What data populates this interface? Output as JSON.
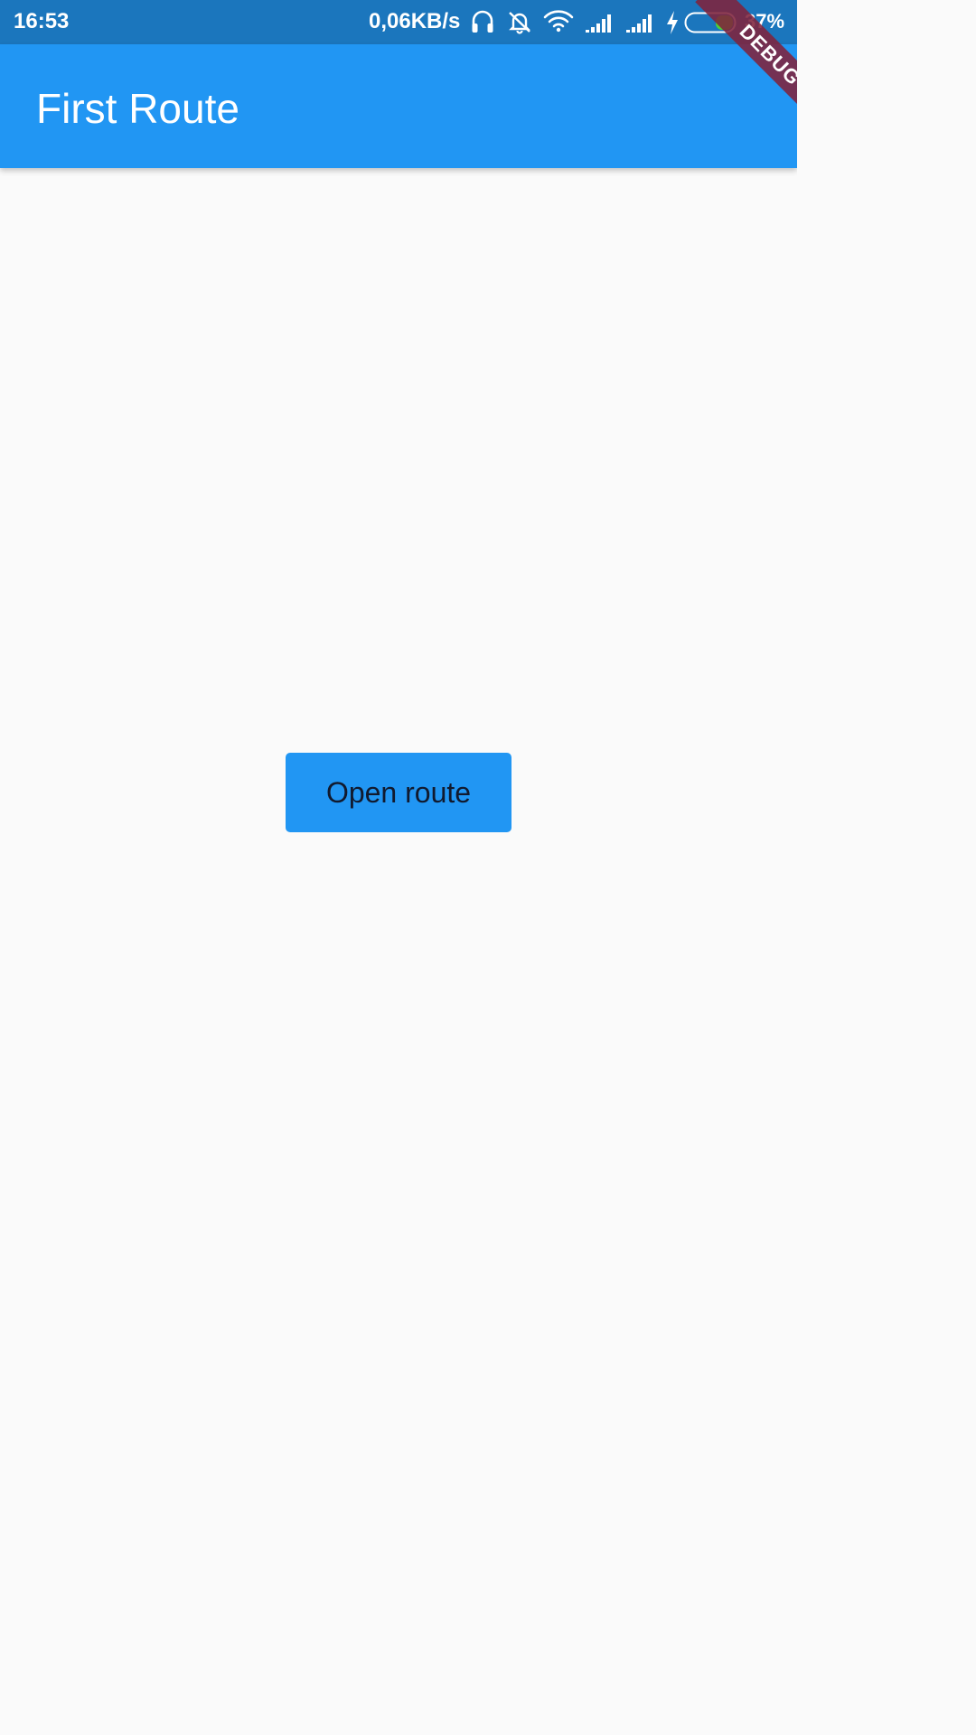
{
  "status_bar": {
    "time": "16:53",
    "network_speed": "0,06KB/s",
    "battery_percent": "37%",
    "icons": [
      "headphones-icon",
      "bell-off-icon",
      "wifi-icon",
      "signal-icon",
      "signal-icon",
      "charging-bolt-icon",
      "battery-icon"
    ],
    "battery_level": 0.37,
    "battery_color": "#4cd137"
  },
  "app_bar": {
    "title": "First Route",
    "color": "#2196f3"
  },
  "main": {
    "open_route_label": "Open route",
    "button_color": "#2196f3"
  },
  "debug_banner": {
    "label": "DEBUG"
  }
}
